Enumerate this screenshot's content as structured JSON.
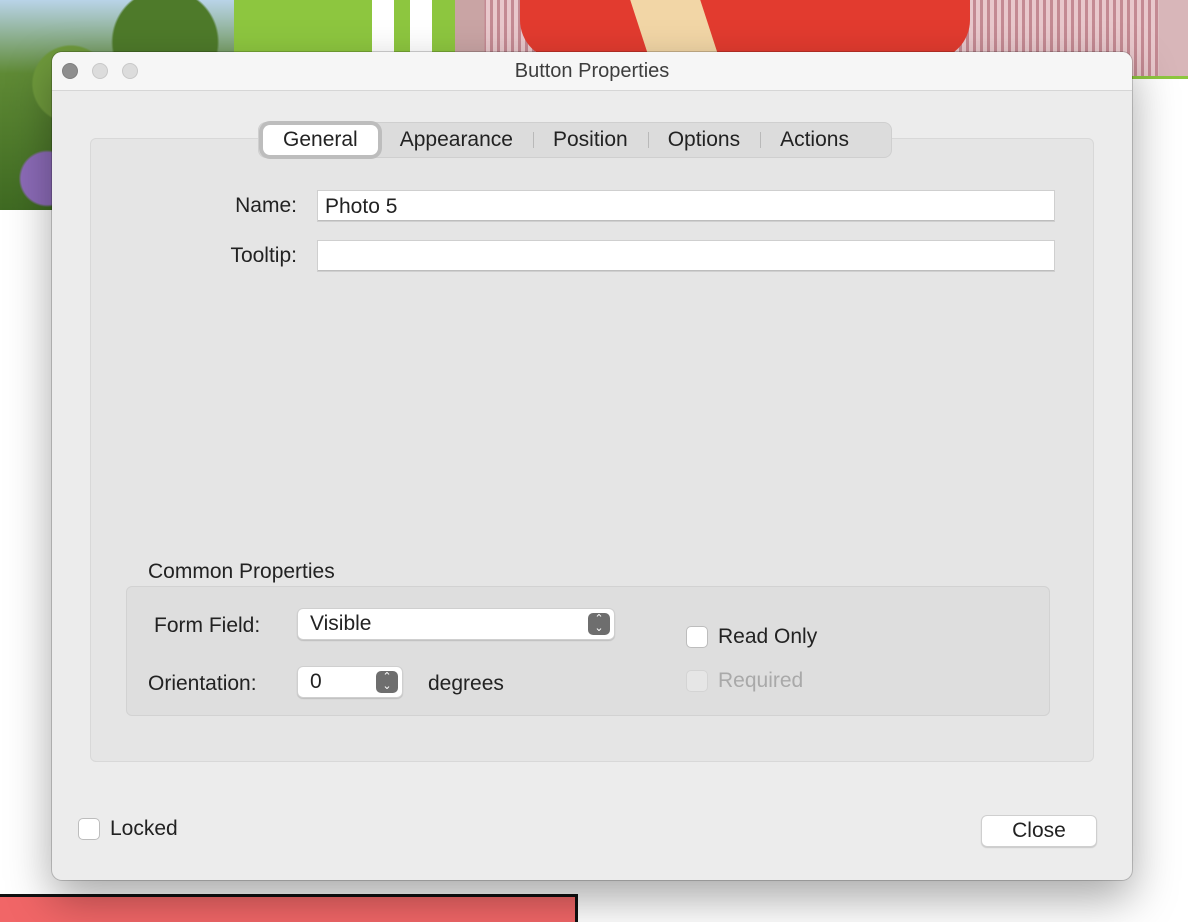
{
  "window": {
    "title": "Button Properties"
  },
  "tabs": [
    {
      "label": "General",
      "active": true
    },
    {
      "label": "Appearance",
      "active": false
    },
    {
      "label": "Position",
      "active": false
    },
    {
      "label": "Options",
      "active": false
    },
    {
      "label": "Actions",
      "active": false
    }
  ],
  "general": {
    "name_label": "Name:",
    "name_value": "Photo 5",
    "tooltip_label": "Tooltip:",
    "tooltip_value": ""
  },
  "common": {
    "section_title": "Common Properties",
    "form_field_label": "Form Field:",
    "form_field_value": "Visible",
    "orientation_label": "Orientation:",
    "orientation_value": "0",
    "degrees_label": "degrees",
    "read_only_label": "Read Only",
    "read_only_checked": false,
    "required_label": "Required",
    "required_checked": false,
    "required_enabled": false
  },
  "footer": {
    "locked_label": "Locked",
    "locked_checked": false,
    "close_label": "Close"
  },
  "colors": {
    "window_bg": "#ececec",
    "panel_bg": "#e5e5e5",
    "accent_green": "#8dc63f",
    "bg_red": "#e23b2f",
    "bg_pink": "#f16667"
  }
}
